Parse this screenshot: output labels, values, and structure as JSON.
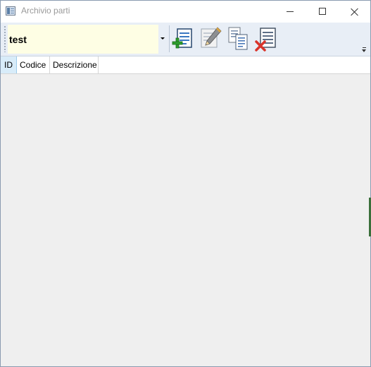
{
  "window": {
    "title": "Archivio parti"
  },
  "toolbar": {
    "combo_value": "test",
    "buttons": [
      {
        "icon": "add-record-icon",
        "accent": "#2e9e2e"
      },
      {
        "icon": "edit-pencil-icon",
        "accent": "#d9a441"
      },
      {
        "icon": "copy-record-icon",
        "accent": "#4a78b8"
      },
      {
        "icon": "delete-record-icon",
        "accent": "#d9342b"
      }
    ]
  },
  "grid": {
    "columns": [
      "ID",
      "Codice",
      "Descrizione"
    ],
    "rows": []
  },
  "colors": {
    "combo_bg": "#fefee4",
    "toolbar_bg": "#e8eef6",
    "grid_bg": "#efefef",
    "selected_header": "#d8ecf9"
  }
}
